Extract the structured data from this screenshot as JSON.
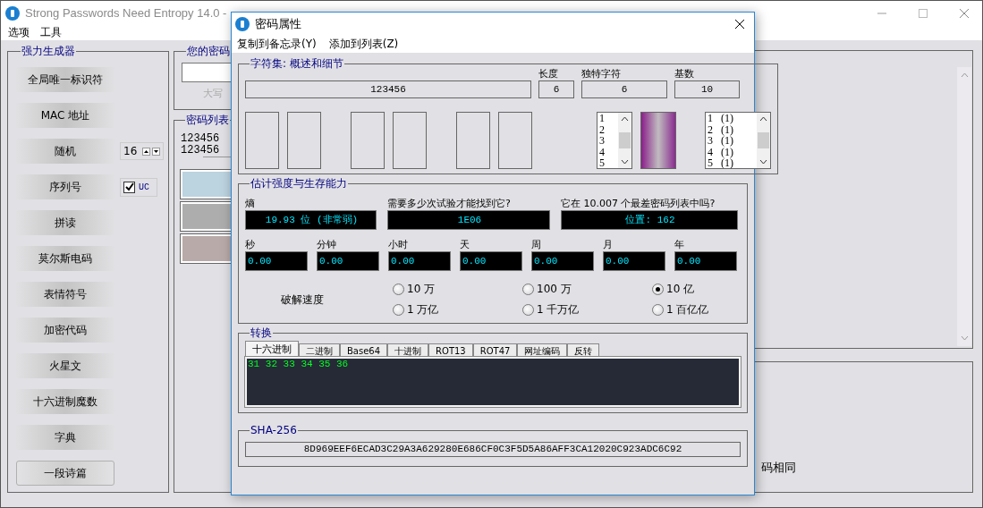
{
  "main_window": {
    "title": "Strong Passwords Need Entropy 14.0 -",
    "menu": [
      "选项",
      "工具"
    ]
  },
  "generator": {
    "title": "强力生成器",
    "buttons": [
      {
        "label": "全局唯一标识符",
        "kind": "plain",
        "focused": false
      },
      {
        "label": "MAC 地址",
        "kind": "plain",
        "focused": false
      },
      {
        "label": "随机",
        "kind": "spinner",
        "value": "16",
        "focused": false
      },
      {
        "label": "序列号",
        "kind": "checkbox",
        "option": "UC",
        "checked": true,
        "focused": false
      },
      {
        "label": "拼读",
        "kind": "plain",
        "focused": false
      },
      {
        "label": "莫尔斯电码",
        "kind": "plain",
        "focused": false
      },
      {
        "label": "表情符号",
        "kind": "plain",
        "focused": false
      },
      {
        "label": "加密代码",
        "kind": "plain",
        "focused": false
      },
      {
        "label": "火星文",
        "kind": "plain",
        "focused": false
      },
      {
        "label": "十六进制魔数",
        "kind": "plain",
        "focused": false
      },
      {
        "label": "字典",
        "kind": "plain",
        "focused": false
      },
      {
        "label": "一段诗篇",
        "kind": "plain",
        "focused": true
      }
    ]
  },
  "your_password": {
    "title": "您的密码",
    "hint": "大写"
  },
  "password_list": {
    "title": "密码列表",
    "items": [
      "123456",
      "123456"
    ],
    "swatches": [
      {
        "color": "#bcd3e0"
      },
      {
        "color": "#adadad"
      },
      {
        "color": "#b8aaa8"
      }
    ]
  },
  "right_panel": {
    "text": "码相同"
  },
  "dialog": {
    "title": "密码属性",
    "menu": [
      "复制到备忘录(Y)",
      "添加到列表(Z)"
    ],
    "charset": {
      "title": "字符集: 概述和细节",
      "password": "123456",
      "stats": [
        {
          "label": "长度",
          "value": "6"
        },
        {
          "label": "独特字符",
          "value": "6"
        },
        {
          "label": "基数",
          "value": "10"
        }
      ],
      "char_list": [
        "1",
        "2",
        "3",
        "4",
        "5"
      ],
      "count_list": [
        {
          "char": "1",
          "count": "(1)"
        },
        {
          "char": "2",
          "count": "(1)"
        },
        {
          "char": "3",
          "count": "(1)"
        },
        {
          "char": "4",
          "count": "(1)"
        },
        {
          "char": "5",
          "count": "(1)"
        }
      ]
    },
    "strength": {
      "title": "估计强度与生存能力",
      "readouts": [
        {
          "label": "熵",
          "value": "19.93 位 (非常弱)"
        },
        {
          "label": "需要多少次试验才能找到它?",
          "value": "1E06"
        },
        {
          "label": "它在 10.007 个最差密码列表中吗?",
          "value": "位置: 162"
        }
      ],
      "times": [
        {
          "label": "秒",
          "value": "0.00"
        },
        {
          "label": "分钟",
          "value": "0.00"
        },
        {
          "label": "小时",
          "value": "0.00"
        },
        {
          "label": "天",
          "value": "0.00"
        },
        {
          "label": "周",
          "value": "0.00"
        },
        {
          "label": "月",
          "value": "0.00"
        },
        {
          "label": "年",
          "value": "0.00"
        }
      ],
      "speed_label": "破解速度",
      "speeds": [
        {
          "label": "10 万",
          "selected": false
        },
        {
          "label": "100 万",
          "selected": false
        },
        {
          "label": "10 亿",
          "selected": true
        },
        {
          "label": "1 万亿",
          "selected": false
        },
        {
          "label": "1 千万亿",
          "selected": false
        },
        {
          "label": "1 百亿亿",
          "selected": false
        }
      ]
    },
    "convert": {
      "title": "转换",
      "tabs": [
        {
          "label": "十六进制",
          "selected": true
        },
        {
          "label": "二进制",
          "selected": false
        },
        {
          "label": "Base64",
          "selected": false
        },
        {
          "label": "十进制",
          "selected": false
        },
        {
          "label": "ROT13",
          "selected": false
        },
        {
          "label": "ROT47",
          "selected": false
        },
        {
          "label": "网址编码",
          "selected": false
        },
        {
          "label": "反转",
          "selected": false
        }
      ],
      "output": "31 32 33 34 35 36"
    },
    "sha": {
      "title": "SHA-256",
      "value": "8D969EEF6ECAD3C29A3A629280E686CF0C3F5D5A86AFF3CA12020C923ADC6C92"
    }
  }
}
